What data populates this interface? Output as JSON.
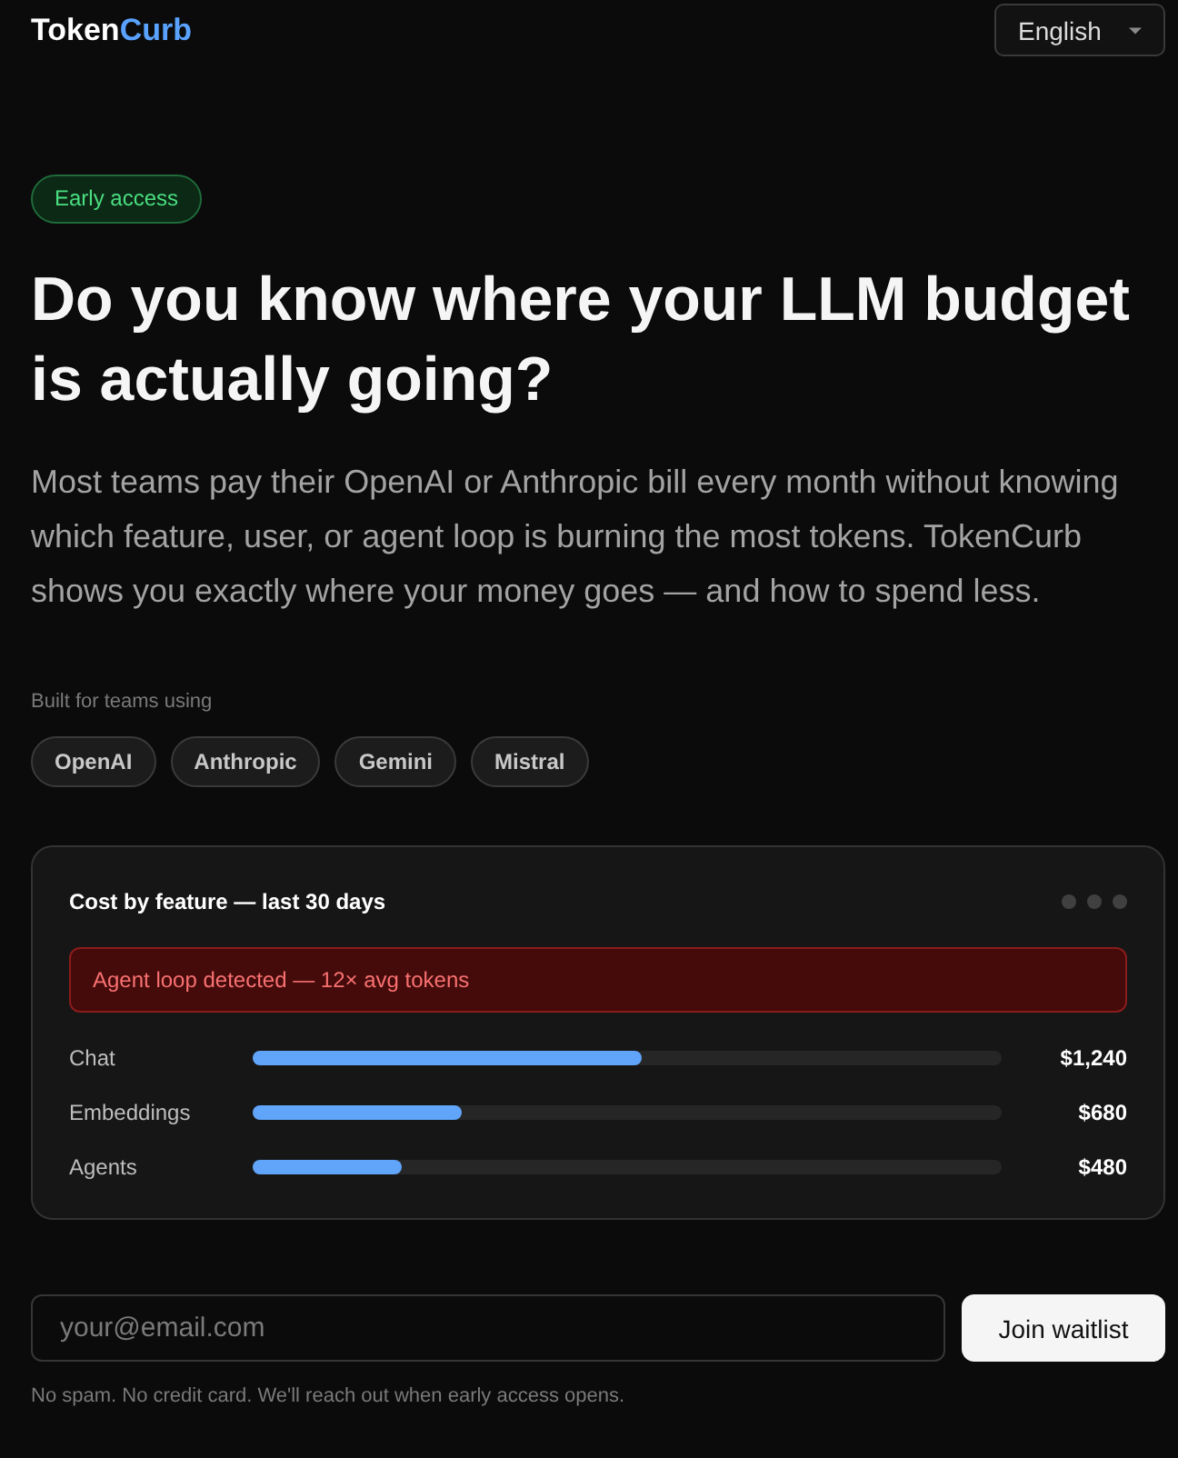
{
  "header": {
    "logo": {
      "primary": "Token",
      "accent": "Curb"
    },
    "language_select": {
      "value": "English"
    }
  },
  "hero": {
    "badge": "Early access",
    "headline": "Do you know where your LLM budget is actually going?",
    "description": "Most teams pay their OpenAI or Anthropic bill every month without knowing which feature, user, or agent loop is burning the most tokens. TokenCurb shows you exactly where your money goes — and how to spend less."
  },
  "providers": {
    "label": "Built for teams using",
    "chips": [
      "OpenAI",
      "Anthropic",
      "Gemini",
      "Mistral"
    ]
  },
  "cost_card": {
    "title": "Cost by feature — last 30 days",
    "alert": "Agent loop detected — 12× avg tokens",
    "rows": [
      {
        "label": "Chat",
        "level": 0.52,
        "value": "$1,240"
      },
      {
        "label": "Embeddings",
        "level": 0.28,
        "value": "$680"
      },
      {
        "label": "Agents",
        "level": 0.2,
        "value": "$480"
      }
    ]
  },
  "waitlist": {
    "email_field": {
      "placeholder": "your@email.com"
    },
    "button": "Join waitlist",
    "note": "No spam. No credit card. We'll reach out when early access opens."
  }
}
